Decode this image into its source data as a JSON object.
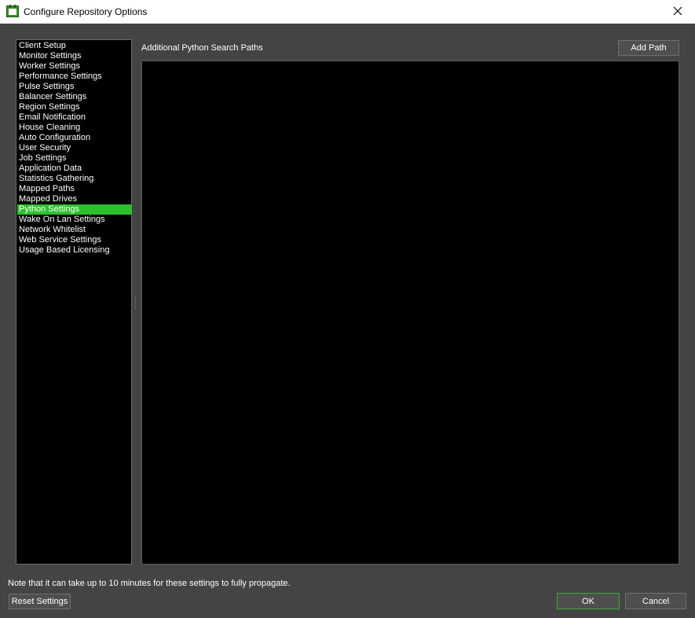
{
  "window": {
    "title": "Configure Repository Options",
    "app_icon": "deadline-icon",
    "close_icon": "close-icon"
  },
  "sidebar": {
    "items": [
      {
        "label": "Client Setup",
        "selected": false
      },
      {
        "label": "Monitor Settings",
        "selected": false
      },
      {
        "label": "Worker Settings",
        "selected": false
      },
      {
        "label": "Performance Settings",
        "selected": false
      },
      {
        "label": "Pulse Settings",
        "selected": false
      },
      {
        "label": "Balancer Settings",
        "selected": false
      },
      {
        "label": "Region Settings",
        "selected": false
      },
      {
        "label": "Email Notification",
        "selected": false
      },
      {
        "label": "House Cleaning",
        "selected": false
      },
      {
        "label": "Auto Configuration",
        "selected": false
      },
      {
        "label": "User Security",
        "selected": false
      },
      {
        "label": "Job Settings",
        "selected": false
      },
      {
        "label": "Application Data",
        "selected": false
      },
      {
        "label": "Statistics Gathering",
        "selected": false
      },
      {
        "label": "Mapped Paths",
        "selected": false
      },
      {
        "label": "Mapped Drives",
        "selected": false
      },
      {
        "label": "Python Settings",
        "selected": true
      },
      {
        "label": "Wake On Lan Settings",
        "selected": false
      },
      {
        "label": "Network Whitelist",
        "selected": false
      },
      {
        "label": "Web Service Settings",
        "selected": false
      },
      {
        "label": "Usage Based Licensing",
        "selected": false
      }
    ]
  },
  "python_settings": {
    "section_label": "Additional Python Search Paths",
    "add_path_label": "Add Path",
    "paths": []
  },
  "footer": {
    "note": "Note that it can take up to 10 minutes for these settings to fully propagate.",
    "reset_label": "Reset Settings",
    "ok_label": "OK",
    "cancel_label": "Cancel"
  },
  "colors": {
    "selection": "#2fbf2f",
    "background": "#444444",
    "list_background": "#000000",
    "ok_border": "#3daa3d"
  }
}
